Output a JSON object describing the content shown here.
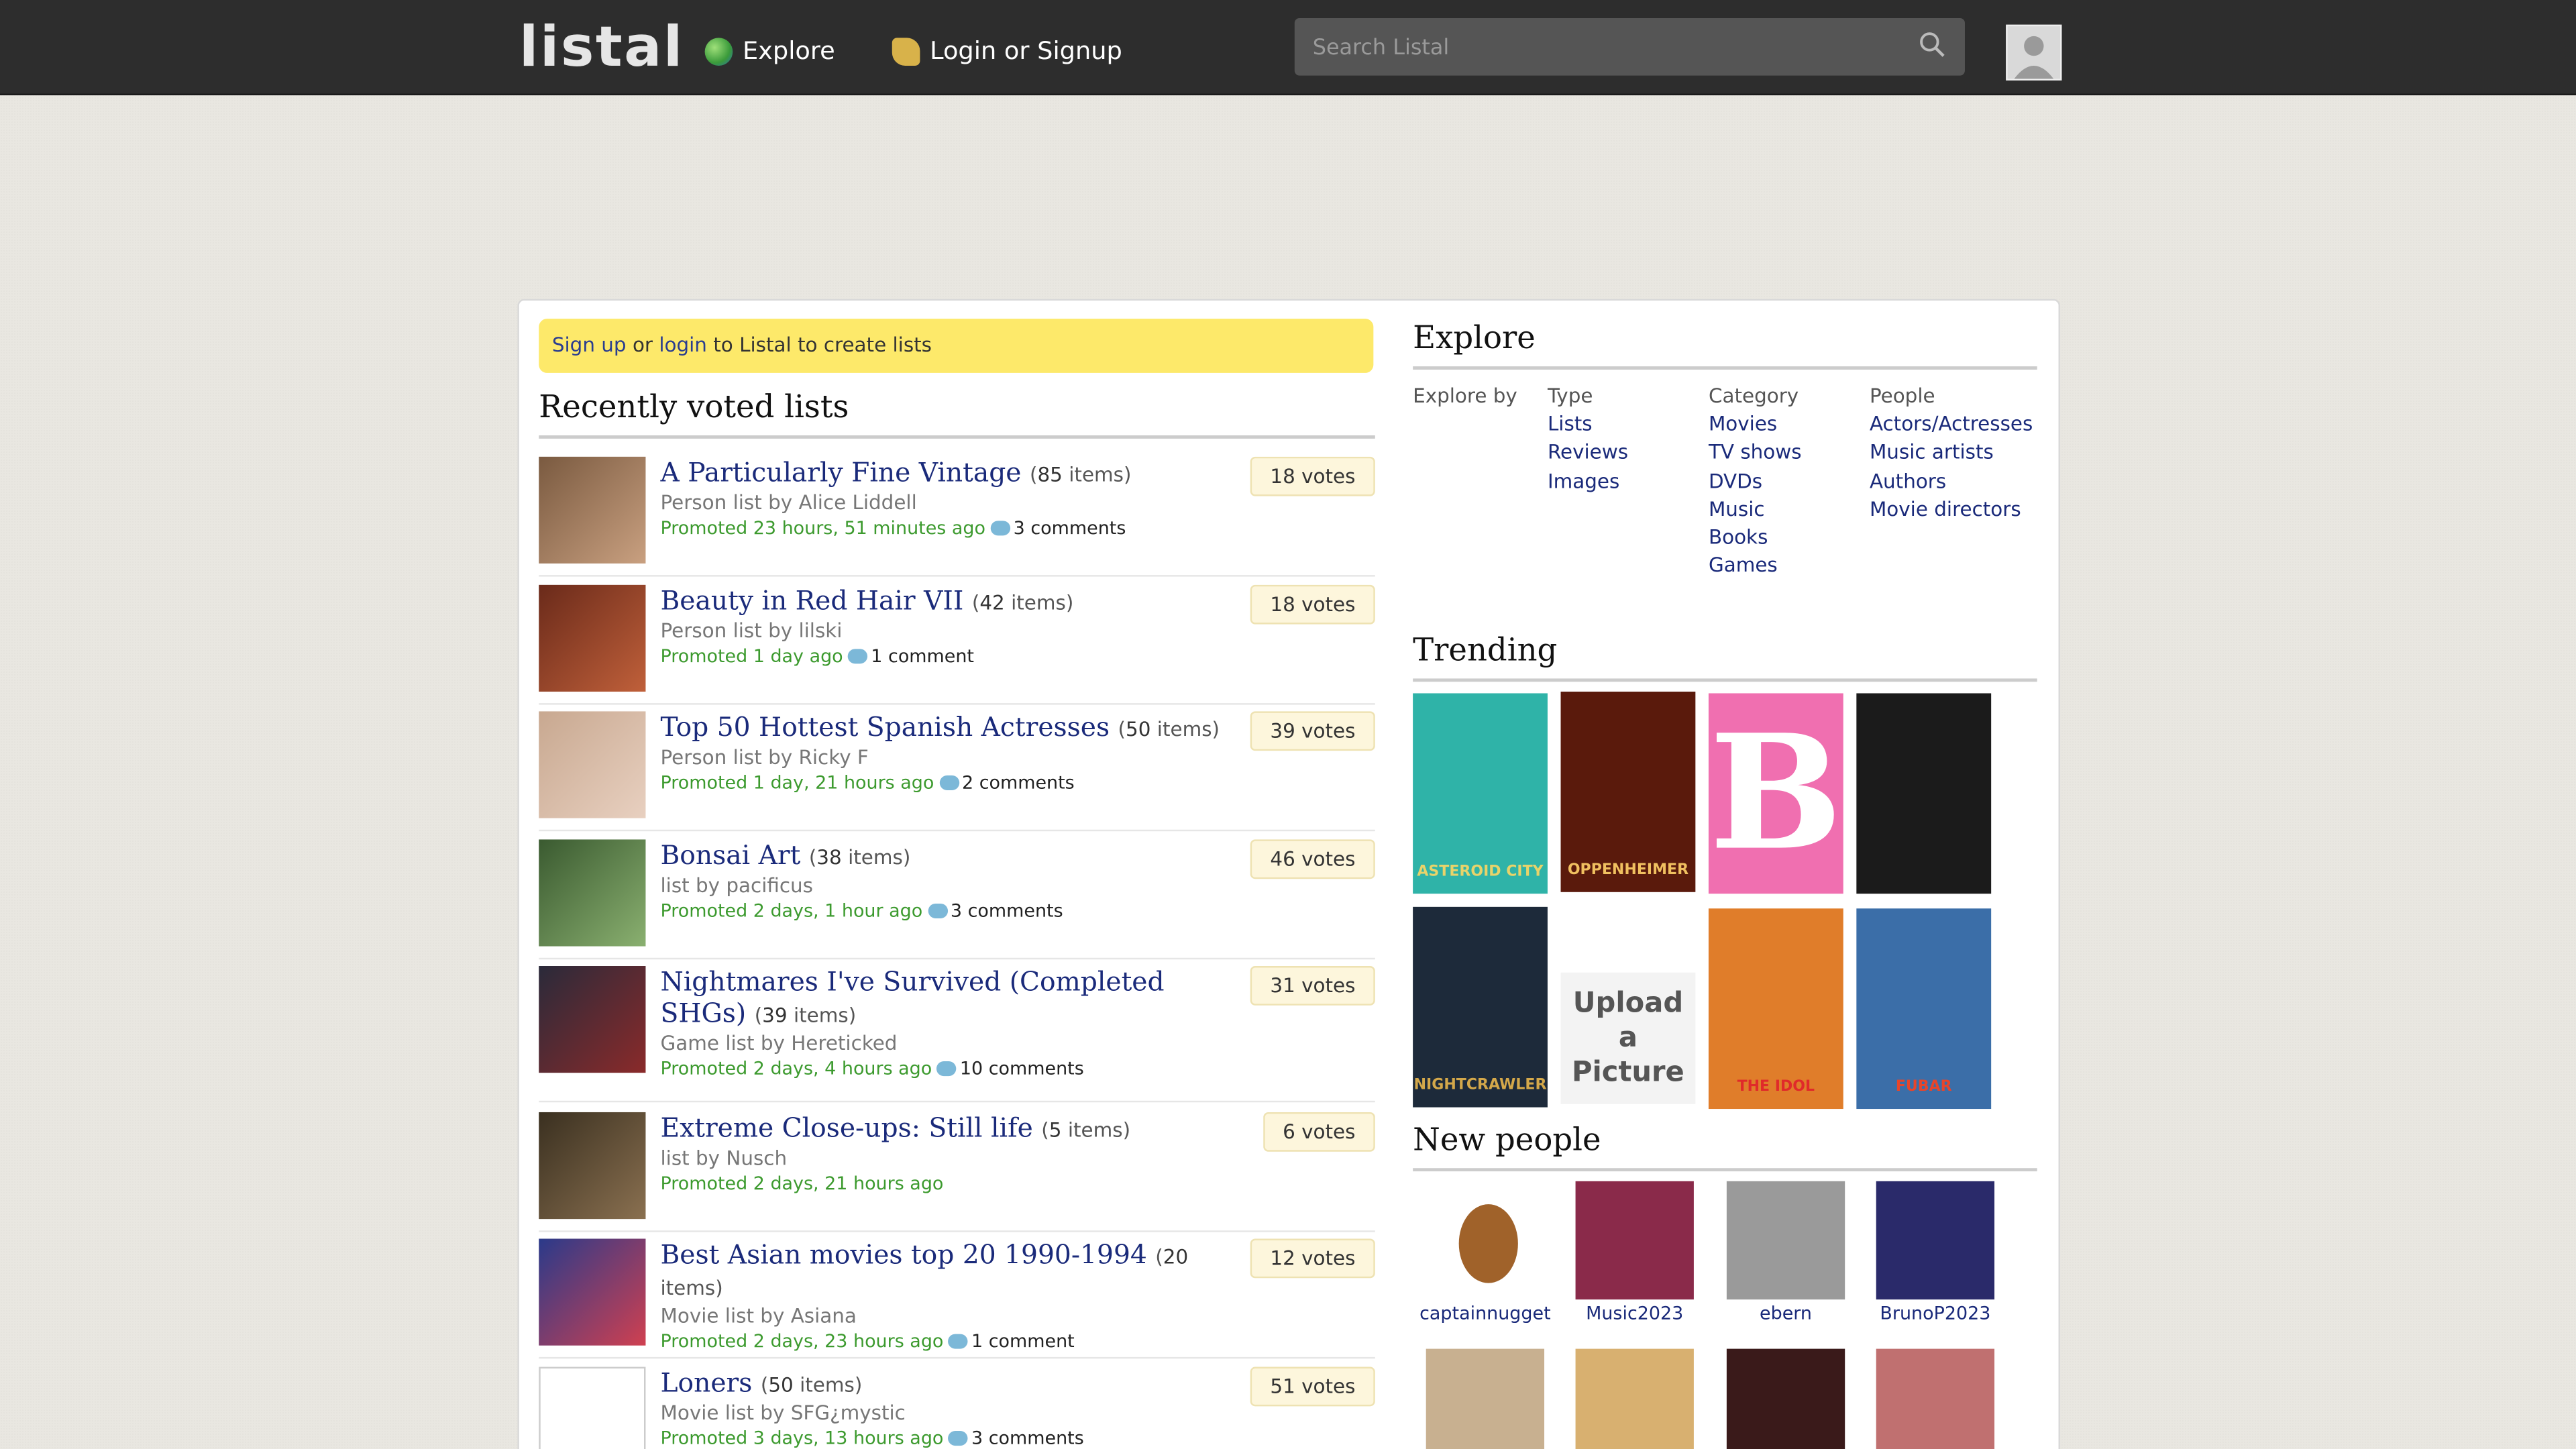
{
  "header": {
    "logo": "listal",
    "explore": "Explore",
    "login": "Login or Signup",
    "search_placeholder": "Search Listal"
  },
  "signup_banner": {
    "signup": "Sign up",
    "or": " or ",
    "login": "login",
    "rest": " to Listal to create lists"
  },
  "recent": {
    "title": "Recently voted lists",
    "items": [
      {
        "title": "A Particularly Fine Vintage",
        "count": "85",
        "count_suffix": "items",
        "sub": "Person list by Alice Liddell",
        "promo": "Promoted 23 hours, 51 minutes ago",
        "comments": "3 comments",
        "votes": "18 votes"
      },
      {
        "title": "Beauty in Red Hair VII",
        "count": "42",
        "count_suffix": "items",
        "sub": "Person list by lilski",
        "promo": "Promoted 1 day ago",
        "comments": "1 comment",
        "votes": "18 votes"
      },
      {
        "title": "Top 50 Hottest Spanish Actresses",
        "count": "50",
        "count_suffix": "items",
        "sub": "Person list by Ricky F",
        "promo": "Promoted 1 day, 21 hours ago",
        "comments": "2 comments",
        "votes": "39 votes"
      },
      {
        "title": "Bonsai Art",
        "count": "38",
        "count_suffix": "items",
        "sub": "list by pacificus",
        "promo": "Promoted 2 days, 1 hour ago",
        "comments": "3 comments",
        "votes": "46 votes"
      },
      {
        "title": "Nightmares I've Survived (Completed SHGs)",
        "count": "39",
        "count_suffix": "items",
        "sub": "Game list by Hereticked",
        "promo": "Promoted 2 days, 4 hours ago",
        "comments": "10 comments",
        "votes": "31 votes"
      },
      {
        "title": "Extreme Close-ups: Still life",
        "count": "5",
        "count_suffix": "items",
        "sub": "list by Nusch",
        "promo": "Promoted 2 days, 21 hours ago",
        "comments": "",
        "votes": "6 votes"
      },
      {
        "title": "Best Asian movies top 20 1990-1994",
        "count": "20",
        "count_suffix": "items",
        "sub": "Movie list by Asiana",
        "promo": "Promoted 2 days, 23 hours ago",
        "comments": "1 comment",
        "votes": "12 votes"
      },
      {
        "title": "Loners",
        "count": "50",
        "count_suffix": "items",
        "sub": "Movie list by SFG¿mystic",
        "promo": "Promoted 3 days, 13 hours ago",
        "comments": "3 comments",
        "votes": "51 votes"
      }
    ]
  },
  "explore": {
    "title": "Explore",
    "by": "Explore by",
    "type": {
      "header": "Type",
      "items": [
        "Lists",
        "Reviews",
        "Images"
      ]
    },
    "category": {
      "header": "Category",
      "items": [
        "Movies",
        "TV shows",
        "DVDs",
        "Music",
        "Books",
        "Games"
      ]
    },
    "people": {
      "header": "People",
      "items": [
        "Actors/Actresses",
        "Music artists",
        "Authors",
        "Movie directors"
      ]
    }
  },
  "trending": {
    "title": "Trending",
    "posters": [
      {
        "text": "ASTEROID CITY",
        "bg": "#2fb3a8",
        "fg": "#e8d36a"
      },
      {
        "text": "OPPENHEIMER",
        "bg": "#5a1a0c",
        "fg": "#f0c060"
      },
      {
        "text": "B",
        "bg": "#f06fb0",
        "fg": "#ffffff"
      },
      {
        "text": "",
        "bg": "#1b1b1b",
        "fg": "#aaaaaa"
      },
      {
        "text": "NIGHTCRAWLER",
        "bg": "#1d2a3a",
        "fg": "#d4a84a"
      },
      {
        "text": "Upload a Picture",
        "bg": "#f3f3f3",
        "fg": "#555555"
      },
      {
        "text": "THE IDOL",
        "bg": "#e07d2a",
        "fg": "#e02a2a"
      },
      {
        "text": "FUBAR",
        "bg": "#3b6ea8",
        "fg": "#e8452a"
      }
    ]
  },
  "new_people": {
    "title": "New people",
    "people": [
      "captainnugget",
      "Music2023",
      "ebern",
      "BrunoP2023",
      "",
      "",
      "",
      ""
    ]
  }
}
